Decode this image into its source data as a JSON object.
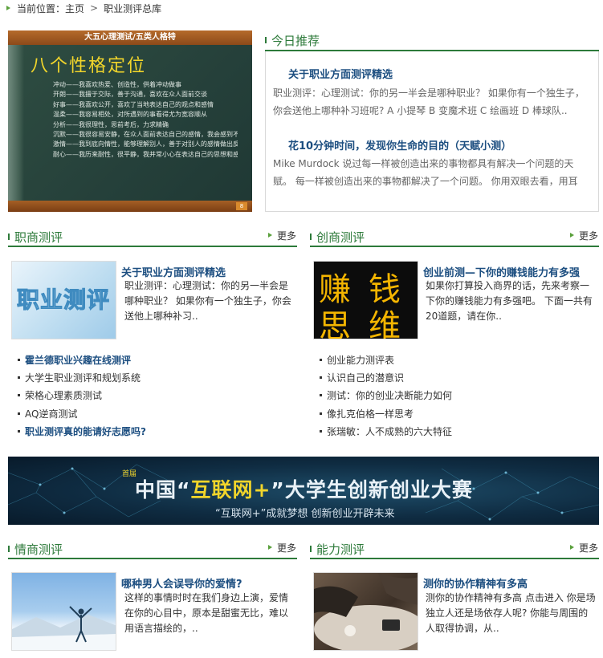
{
  "breadcrumb": {
    "label": "当前位置：",
    "home": "主页",
    "current": "职业测评总库"
  },
  "hero": {
    "header": "大五心理测试/五类人格特",
    "title": "八个性格定位",
    "lines": [
      "冲动——我喜欢热爱、创造性，供着冲动做事",
      "开朗——我擅于交际，善于沟通，喜欢在众人面前交谈",
      "好事——我喜欢公开，喜欢了当地表达自己的观点和感情",
      "温柔——我容易相处，对所遇到的事看得尤为宽容顺从",
      "分析——我很理性，思前考后，力求精确",
      "沉默——我很容易安静，在众人面前表达自己的感情，我会感到不舒服",
      "激情——我到底向情性，能够理解别人，善于对别人的感情做出反应",
      "耐心——我历来耐性，很平静，我并常小心在表达自己的思想和感情时，慢而谨慎别人"
    ],
    "page": "8"
  },
  "today": {
    "title": "今日推荐",
    "items": [
      {
        "title": "关于职业方面测评精选",
        "desc": "职业测评：心理测试：你的另一半会是哪种职业？ 如果你有一个独生子，你会送他上哪种补习班呢? A 小提琴 B 变魔术班 C 绘画班 D 棒球队.."
      },
      {
        "title": "花10分钟时间，发现你生命的目的（天赋小测）",
        "desc": "Mike Murdock 说过每一样被创造出来的事物都具有解决一个问题的天赋。 每一样被创造出来的事物都解决了一个问题。 你用双眼去看，用耳朵.."
      }
    ]
  },
  "more_label": "更多",
  "sections": {
    "career": {
      "title": "职商测评",
      "thumb_text": "职业测评",
      "feature_title": "关于职业方面测评精选",
      "feature_desc": "职业测评：心理测试：你的另一半会是哪种职业？ 如果你有一个独生子，你会送他上哪种补习..",
      "list": [
        "霍兰德职业兴趣在线测评",
        "大学生职业测评和规划系统",
        "荣格心理素质测试",
        "AQ逆商测试",
        "职业测评真的能请好志愿吗?"
      ]
    },
    "startup": {
      "title": "创商测评",
      "thumb_words": [
        "赚",
        "钱",
        "思",
        "维"
      ],
      "feature_title": "创业前测—下你的赚钱能力有多强",
      "feature_desc": "如果你打算投入商界的话，先来考察一下你的赚钱能力有多强吧。 下面一共有20道题，请在你..",
      "list": [
        "创业能力测评表",
        "认识自己的潜意识",
        "测试：你的创业决断能力如何",
        "像扎克伯格一样思考",
        "张瑞敏：人不成熟的六大特征"
      ]
    },
    "emotion": {
      "title": "情商测评",
      "feature_title": "哪种男人会误导你的爱情?",
      "feature_desc": "这样的事情时时在我们身边上演，爱情在你的心目中，原本是甜蜜无比，难以用语言描绘的，.."
    },
    "ability": {
      "title": "能力测评",
      "feature_title": "测你的协作精神有多高",
      "feature_desc": "测你的协作精神有多高 点击进入 你是场独立人还是场依存人呢? 你能与周围的人取得协调，从.."
    }
  },
  "banner": {
    "small": "首届",
    "main_pre": "中国“",
    "main_hl": "互联网+",
    "main_post": "”大学生创新创业大赛",
    "sub": "“互联网+”成就梦想 创新创业开辟未来"
  }
}
